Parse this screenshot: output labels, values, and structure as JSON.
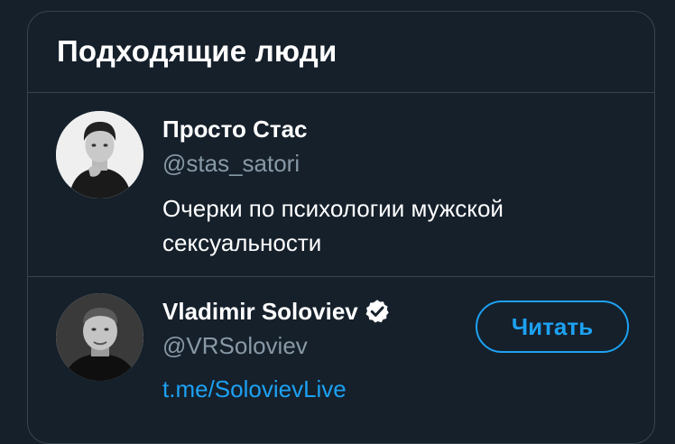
{
  "panel": {
    "title": "Подходящие люди"
  },
  "people": [
    {
      "name": "Просто Стас",
      "handle": "@stas_satori",
      "bio": "Очерки по психологии мужской сексуальности",
      "verified": false
    },
    {
      "name": "Vladimir Soloviev",
      "handle": "@VRSoloviev",
      "link": "t.me/SolovievLive",
      "verified": true,
      "follow_label": "Читать"
    }
  ],
  "colors": {
    "background": "#15202b",
    "border": "#38444d",
    "text_primary": "#ffffff",
    "text_secondary": "#8899a6",
    "accent": "#1da1f2"
  },
  "icons": {
    "verified": "verified-badge-icon"
  }
}
